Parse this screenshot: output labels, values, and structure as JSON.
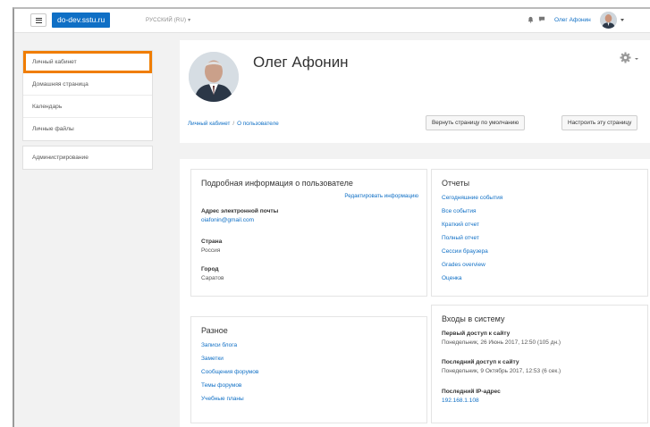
{
  "navbar": {
    "site": "do-dev.sstu.ru",
    "language": "РУССКИЙ (RU) ▾",
    "user_name": "Олег Афонин"
  },
  "sidebar": {
    "items": [
      {
        "label": "Личный кабинет",
        "active": true
      },
      {
        "label": "Домашняя страница"
      },
      {
        "label": "Календарь"
      },
      {
        "label": "Личные файлы"
      }
    ],
    "admin": {
      "label": "Администрирование"
    }
  },
  "header": {
    "name": "Олег Афонин",
    "breadcrumb": [
      "Личный кабинет",
      "О пользователе"
    ],
    "reset_button": "Вернуть страницу по умолчанию",
    "customize_button": "Настроить эту страницу"
  },
  "details": {
    "title": "Подробная информация о пользователе",
    "edit_link": "Редактировать информацию",
    "email_label": "Адрес электронной почты",
    "email": "oiafonin@gmail.com",
    "country_label": "Страна",
    "country": "Россия",
    "city_label": "Город",
    "city": "Саратов"
  },
  "reports": {
    "title": "Отчеты",
    "links": [
      "Сегодняшние события",
      "Все события",
      "Краткий отчет",
      "Полный отчет",
      "Сессии браузера",
      "Grades overview",
      "Оценка"
    ]
  },
  "misc": {
    "title": "Разное",
    "links": [
      "Записи блога",
      "Заметки",
      "Сообщения форумов",
      "Темы форумов",
      "Учебные планы"
    ]
  },
  "logins": {
    "title": "Входы в систему",
    "first_label": "Первый доступ к сайту",
    "first_value": "Понедельник, 26 Июнь 2017, 12:50  (105 дн.)",
    "last_label": "Последний доступ к сайту",
    "last_value": "Понедельник, 9 Октябрь 2017, 12:53  (6 сек.)",
    "ip_label": "Последний IP-адрес",
    "ip_value": "192.168.1.108"
  },
  "colors": {
    "accent": "#0f6fc5",
    "highlight": "#f07d00"
  }
}
